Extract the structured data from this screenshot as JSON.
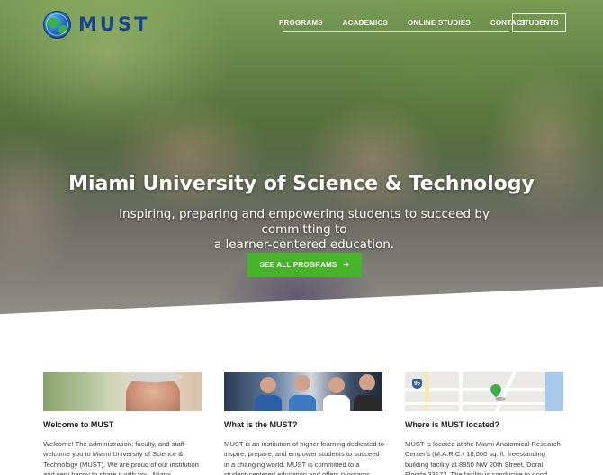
{
  "brand": {
    "logo_text": "MUST"
  },
  "nav": {
    "items": [
      "PROGRAMS",
      "ACADEMICS",
      "ONLINE STUDIES",
      "CONTACT"
    ],
    "students_label": "STUDENTS"
  },
  "hero": {
    "title": "Miami University of Science & Technology",
    "subtitle_line1": "Inspiring, preparing and empowering students to succeed by committing to",
    "subtitle_line2": "a learner-centered education.",
    "cta_label": "SEE ALL PROGRAMS",
    "cta_icon": "arrow-right-icon",
    "accent_color": "#47b32a"
  },
  "cards": [
    {
      "title": "Welcome to MUST",
      "text": "Welcome! The administration, faculty, and staff welcome you to Miami University of Science & Technology (MUST). We are proud of our institution and very happy to share it with you. Miami"
    },
    {
      "title": "What is the MUST?",
      "text": "MUST is an institution of higher learning dedicated to inspire, prepare, and empower students to succeed in a changing world. MUST is committed to a student-centered education and offers programs"
    },
    {
      "title": "Where is MUST located?",
      "text": "MUST is located at the Miami Anatomical Research Center's (M.A.R.C.) 18,000 sq. ft. freestanding building facility at 8850 NW 20th Street, Doral, Florida 33172. The facility is conducive to good",
      "map_route_label": "95"
    }
  ]
}
